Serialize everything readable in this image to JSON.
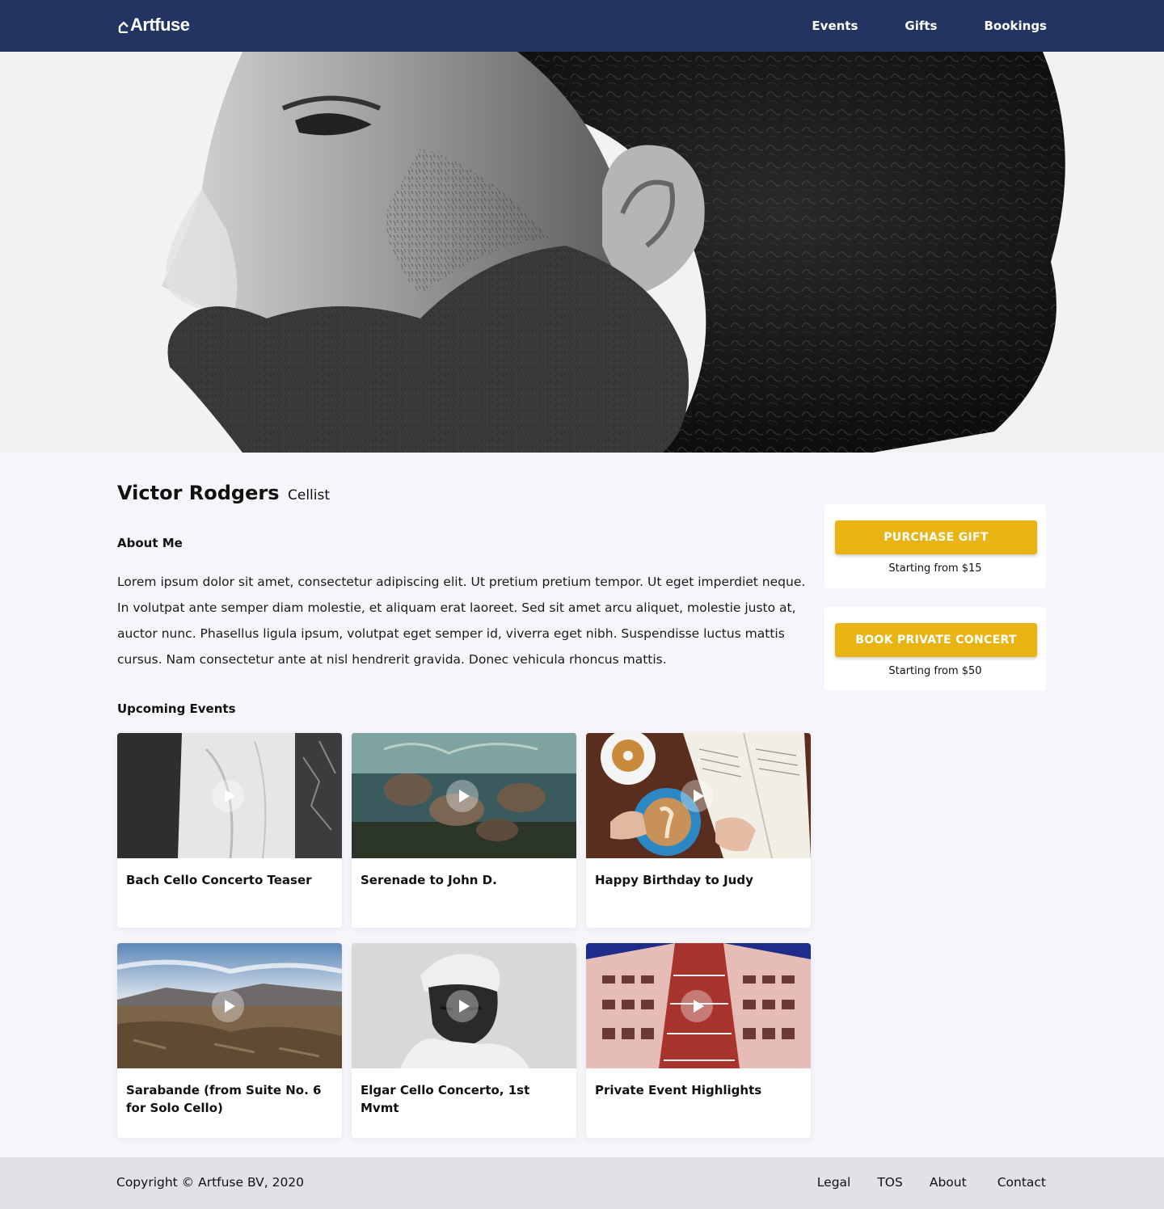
{
  "header": {
    "logo_text": "Artfuse",
    "nav": [
      {
        "label": "Events"
      },
      {
        "label": "Gifts"
      },
      {
        "label": "Bookings"
      }
    ]
  },
  "profile": {
    "name": "Victor Rodgers",
    "role": "Cellist",
    "about_title": "About Me",
    "about_text": "Lorem ipsum dolor sit amet, consectetur adipiscing elit. Ut pretium pretium tempor. Ut eget imperdiet neque. In volutpat ante semper diam molestie, et aliquam erat laoreet. Sed sit amet arcu aliquet, molestie justo at, auctor nunc. Phasellus ligula ipsum, volutpat eget semper id, viverra eget nibh. Suspendisse luctus mattis cursus. Nam consectetur ante at nisl hendrerit gravida. Donec vehicula rhoncus mattis."
  },
  "actions": [
    {
      "label": "PURCHASE GIFT",
      "sub": "Starting from $15"
    },
    {
      "label": "BOOK PRIVATE CONCERT",
      "sub": "Starting from $50"
    }
  ],
  "events_title": "Upcoming Events",
  "events": [
    {
      "title": "Bach Cello Concerto Teaser"
    },
    {
      "title": "Serenade to John D."
    },
    {
      "title": "Happy Birthday to Judy"
    },
    {
      "title": "Sarabande (from Suite No. 6 for Solo Cello)"
    },
    {
      "title": "Elgar Cello Concerto, 1st Mvmt"
    },
    {
      "title": "Private Event Highlights"
    }
  ],
  "footer": {
    "copyright": "Copyright © Artfuse BV, 2020",
    "links": [
      {
        "label": "Legal"
      },
      {
        "label": "TOS"
      },
      {
        "label": "About"
      },
      {
        "label": "Contact"
      }
    ]
  },
  "colors": {
    "header_bg": "#233362",
    "accent": "#e8b413",
    "page_bg": "#f5f5fa",
    "footer_bg": "#e2e2e6"
  }
}
